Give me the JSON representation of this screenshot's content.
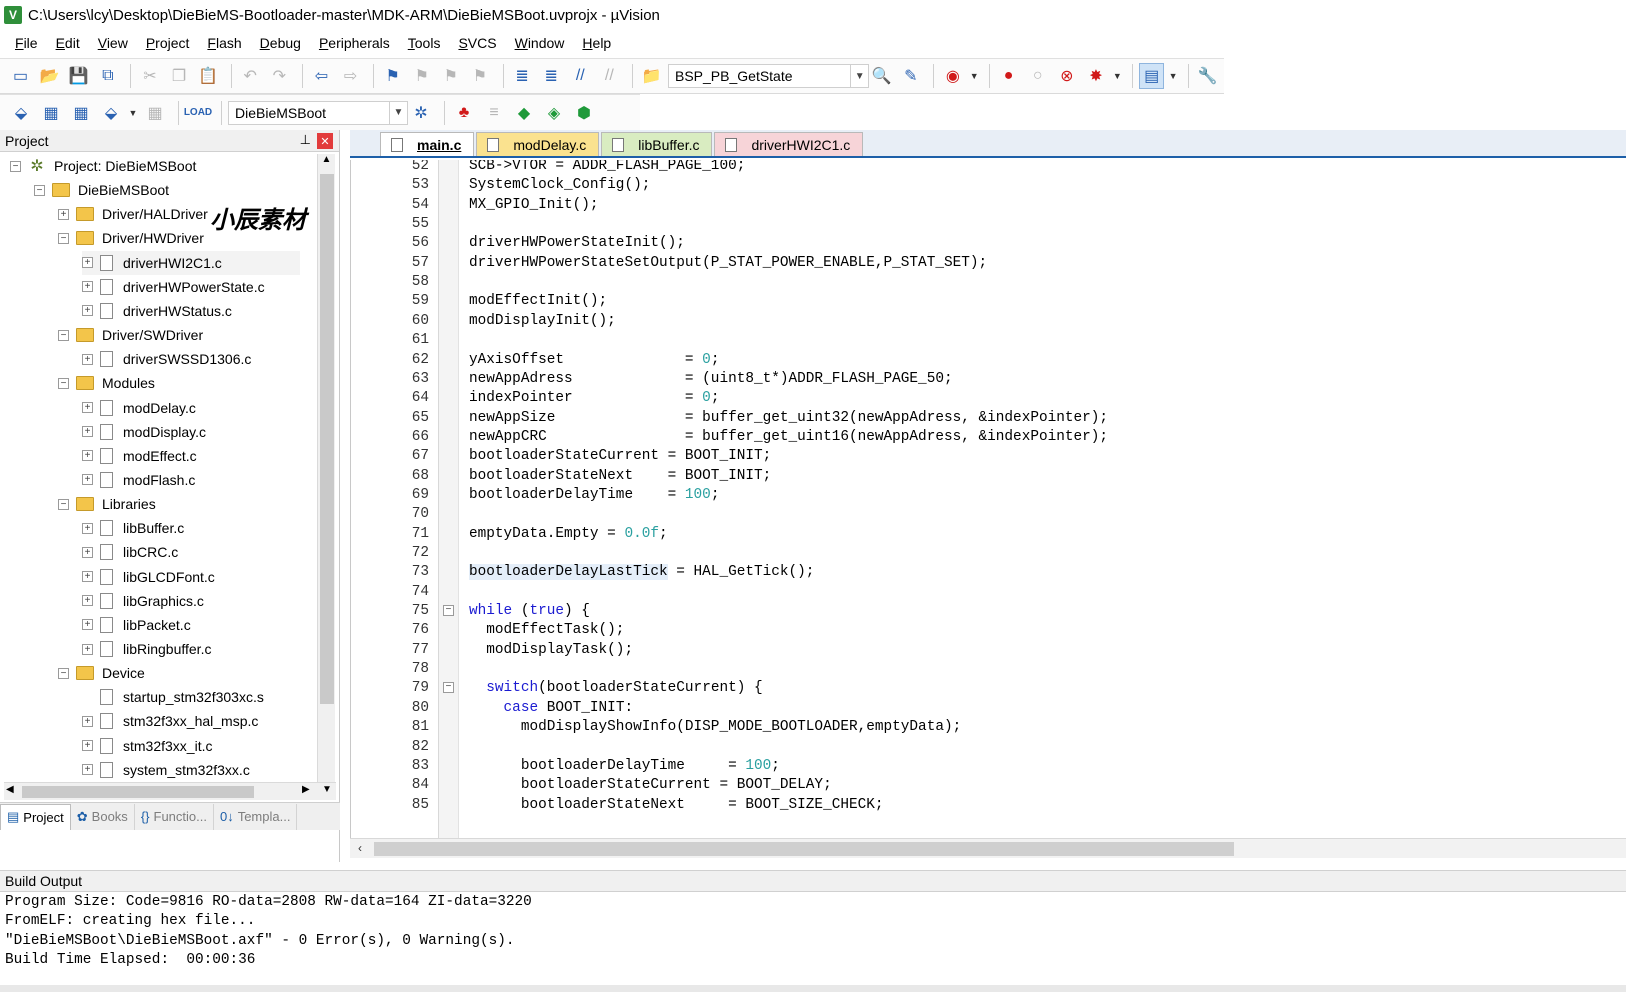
{
  "window": {
    "title": "C:\\Users\\lcy\\Desktop\\DieBieMS-Bootloader-master\\MDK-ARM\\DieBieMSBoot.uvprojx - µVision",
    "app_icon": "V"
  },
  "menu": [
    "File",
    "Edit",
    "View",
    "Project",
    "Flash",
    "Debug",
    "Peripherals",
    "Tools",
    "SVCS",
    "Window",
    "Help"
  ],
  "toolbar1": {
    "function_combo_value": "BSP_PB_GetState"
  },
  "toolbar2": {
    "target_combo_value": "DieBieMSBoot"
  },
  "project_pane": {
    "header": "Project",
    "watermark": "小辰素材",
    "tree": [
      {
        "label": "Project: DieBieMSBoot",
        "type": "project",
        "level": 0,
        "expander": "−"
      },
      {
        "label": "DieBieMSBoot",
        "type": "target",
        "level": 1,
        "expander": "−"
      },
      {
        "label": "Driver/HALDriver",
        "type": "folder",
        "level": 2,
        "expander": "+"
      },
      {
        "label": "Driver/HWDriver",
        "type": "folder",
        "level": 2,
        "expander": "−"
      },
      {
        "label": "driverHWI2C1.c",
        "type": "file",
        "level": 3,
        "expander": "+",
        "selected": true
      },
      {
        "label": "driverHWPowerState.c",
        "type": "file",
        "level": 3,
        "expander": "+"
      },
      {
        "label": "driverHWStatus.c",
        "type": "file",
        "level": 3,
        "expander": "+"
      },
      {
        "label": "Driver/SWDriver",
        "type": "folder",
        "level": 2,
        "expander": "−"
      },
      {
        "label": "driverSWSSD1306.c",
        "type": "file",
        "level": 3,
        "expander": "+"
      },
      {
        "label": "Modules",
        "type": "folder",
        "level": 2,
        "expander": "−"
      },
      {
        "label": "modDelay.c",
        "type": "file",
        "level": 3,
        "expander": "+"
      },
      {
        "label": "modDisplay.c",
        "type": "file",
        "level": 3,
        "expander": "+"
      },
      {
        "label": "modEffect.c",
        "type": "file",
        "level": 3,
        "expander": "+"
      },
      {
        "label": "modFlash.c",
        "type": "file",
        "level": 3,
        "expander": "+"
      },
      {
        "label": "Libraries",
        "type": "folder",
        "level": 2,
        "expander": "−"
      },
      {
        "label": "libBuffer.c",
        "type": "file",
        "level": 3,
        "expander": "+"
      },
      {
        "label": "libCRC.c",
        "type": "file",
        "level": 3,
        "expander": "+"
      },
      {
        "label": "libGLCDFont.c",
        "type": "file",
        "level": 3,
        "expander": "+"
      },
      {
        "label": "libGraphics.c",
        "type": "file",
        "level": 3,
        "expander": "+"
      },
      {
        "label": "libPacket.c",
        "type": "file",
        "level": 3,
        "expander": "+"
      },
      {
        "label": "libRingbuffer.c",
        "type": "file",
        "level": 3,
        "expander": "+"
      },
      {
        "label": "Device",
        "type": "folder",
        "level": 2,
        "expander": "−"
      },
      {
        "label": "startup_stm32f303xc.s",
        "type": "file",
        "level": 3,
        "expander": ""
      },
      {
        "label": "stm32f3xx_hal_msp.c",
        "type": "file",
        "level": 3,
        "expander": "+"
      },
      {
        "label": "stm32f3xx_it.c",
        "type": "file",
        "level": 3,
        "expander": "+"
      },
      {
        "label": "system_stm32f3xx.c",
        "type": "file",
        "level": 3,
        "expander": "+"
      }
    ],
    "tabs": [
      {
        "label": "Project",
        "icon": "project-icon",
        "active": true
      },
      {
        "label": "Books",
        "icon": "books-icon",
        "active": false
      },
      {
        "label": "Functio...",
        "icon": "functions-icon",
        "active": false
      },
      {
        "label": "Templa...",
        "icon": "templates-icon",
        "active": false
      }
    ]
  },
  "editor": {
    "tabs": [
      {
        "label": "main.c",
        "style": "active"
      },
      {
        "label": "modDelay.c",
        "style": "yellow"
      },
      {
        "label": "libBuffer.c",
        "style": "green"
      },
      {
        "label": "driverHWI2C1.c",
        "style": "pink"
      }
    ],
    "lines": [
      {
        "n": "52",
        "code": "SCB->VTOR = ADDR_FLASH_PAGE_100;"
      },
      {
        "n": "53",
        "code": "SystemClock_Config();"
      },
      {
        "n": "54",
        "code": "MX_GPIO_Init();"
      },
      {
        "n": "55",
        "code": ""
      },
      {
        "n": "56",
        "code": "driverHWPowerStateInit();"
      },
      {
        "n": "57",
        "code": "driverHWPowerStateSetOutput(P_STAT_POWER_ENABLE,P_STAT_SET);"
      },
      {
        "n": "58",
        "code": ""
      },
      {
        "n": "59",
        "code": "modEffectInit();"
      },
      {
        "n": "60",
        "code": "modDisplayInit();"
      },
      {
        "n": "61",
        "code": ""
      },
      {
        "n": "62",
        "code": "yAxisOffset              = <n>0</n>;"
      },
      {
        "n": "63",
        "code": "newAppAdress             = (uint8_t*)ADDR_FLASH_PAGE_50;"
      },
      {
        "n": "64",
        "code": "indexPointer             = <n>0</n>;"
      },
      {
        "n": "65",
        "code": "newAppSize               = buffer_get_uint32(newAppAdress, &indexPointer);"
      },
      {
        "n": "66",
        "code": "newAppCRC                = buffer_get_uint16(newAppAdress, &indexPointer);"
      },
      {
        "n": "67",
        "code": "bootloaderStateCurrent = BOOT_INIT;"
      },
      {
        "n": "68",
        "code": "bootloaderStateNext    = BOOT_INIT;"
      },
      {
        "n": "69",
        "code": "bootloaderDelayTime    = <n>100</n>;"
      },
      {
        "n": "70",
        "code": ""
      },
      {
        "n": "71",
        "code": "emptyData.Empty = <n>0.0f</n>;"
      },
      {
        "n": "72",
        "code": ""
      },
      {
        "n": "73",
        "code": "<h>bootloaderDelayLastTick</h> = HAL_GetTick();"
      },
      {
        "n": "74",
        "code": ""
      },
      {
        "n": "75",
        "code": "<k>while</k> (<k>true</k>) {",
        "fold": true
      },
      {
        "n": "76",
        "code": "  modEffectTask();"
      },
      {
        "n": "77",
        "code": "  modDisplayTask();"
      },
      {
        "n": "78",
        "code": ""
      },
      {
        "n": "79",
        "code": "  <k>switch</k>(bootloaderStateCurrent) {",
        "fold": true
      },
      {
        "n": "80",
        "code": "    <k>case</k> BOOT_INIT:"
      },
      {
        "n": "81",
        "code": "      modDisplayShowInfo(DISP_MODE_BOOTLOADER,emptyData);"
      },
      {
        "n": "82",
        "code": ""
      },
      {
        "n": "83",
        "code": "      bootloaderDelayTime     = <n>100</n>;"
      },
      {
        "n": "84",
        "code": "      bootloaderStateCurrent = BOOT_DELAY;"
      },
      {
        "n": "85",
        "code": "      bootloaderStateNext     = BOOT_SIZE_CHECK;"
      }
    ]
  },
  "build_output": {
    "header": "Build Output",
    "lines": [
      "Program Size: Code=9816 RO-data=2808 RW-data=164 ZI-data=3220",
      "FromELF: creating hex file...",
      "\"DieBieMSBoot\\DieBieMSBoot.axf\" - 0 Error(s), 0 Warning(s).",
      "Build Time Elapsed:  00:00:36"
    ]
  },
  "colors": {
    "keyword": "#1b1bd1",
    "number": "#2aa0a0",
    "tab_accent": "#1d5fa8"
  }
}
